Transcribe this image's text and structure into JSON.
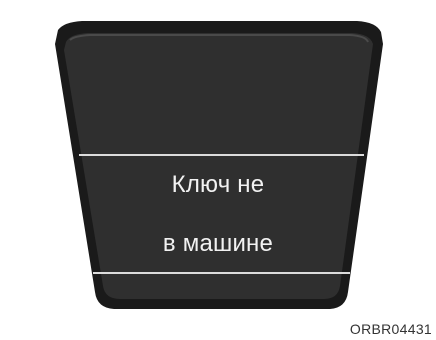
{
  "display": {
    "message_line_1": "Ключ не",
    "message_line_2": "в машине",
    "colors": {
      "bezel": "#1a1a1a",
      "screen": "#2f2f2f",
      "divider": "#dcdcdc",
      "text": "#f2f2f2"
    }
  },
  "figure_code": "ORBR04431"
}
